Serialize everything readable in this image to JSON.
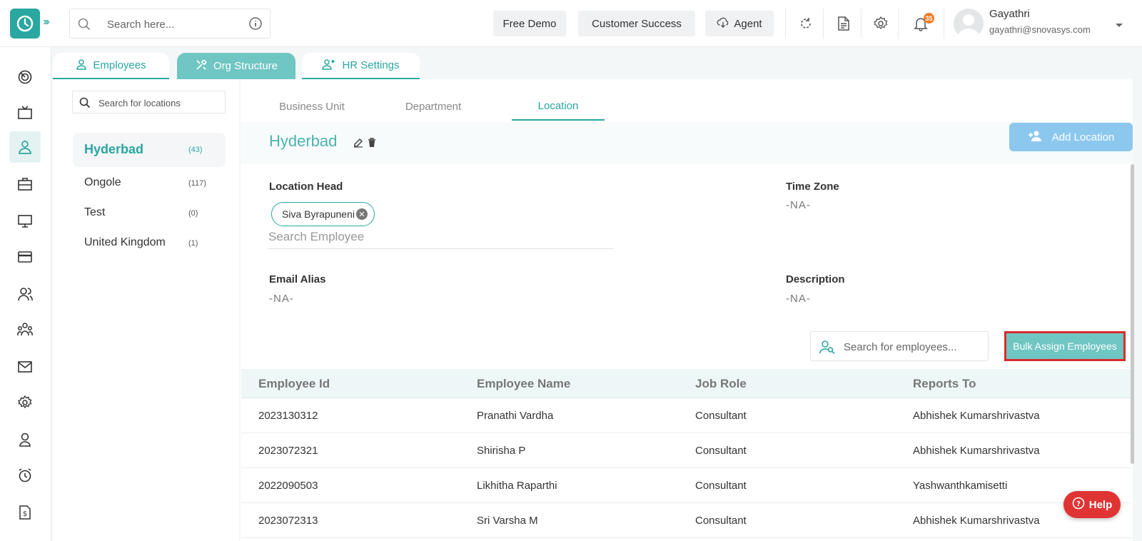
{
  "topbar": {
    "search_placeholder": "Search here...",
    "buttons": {
      "free_demo": "Free Demo",
      "customer_success": "Customer Success",
      "agent": "Agent"
    },
    "notification_count": "35",
    "user": {
      "name": "Gayathri",
      "email": "gayathri@snovasys.com"
    }
  },
  "tabs": [
    {
      "label": "Employees",
      "active": false
    },
    {
      "label": "Org Structure",
      "active": true
    },
    {
      "label": "HR Settings",
      "active": false
    }
  ],
  "locations": {
    "search_placeholder": "Search for locations",
    "items": [
      {
        "name": "Hyderbad",
        "count": "(43)",
        "active": true
      },
      {
        "name": "Ongole",
        "count": "(117)",
        "active": false
      },
      {
        "name": "Test",
        "count": "(0)",
        "active": false
      },
      {
        "name": "United Kingdom",
        "count": "(1)",
        "active": false
      }
    ]
  },
  "sub_tabs": [
    {
      "label": "Business Unit",
      "active": false
    },
    {
      "label": "Department",
      "active": false
    },
    {
      "label": "Location",
      "active": true
    }
  ],
  "detail": {
    "title": "Hyderbad",
    "add_location": "Add Location",
    "location_head_label": "Location Head",
    "location_head_chip": "Siva Byrapuneni",
    "search_employee_placeholder": "Search Employee",
    "time_zone_label": "Time Zone",
    "time_zone_value": "-NA-",
    "email_alias_label": "Email Alias",
    "email_alias_value": "-NA-",
    "description_label": "Description",
    "description_value": "-NA-",
    "search_employees_placeholder": "Search for employees...",
    "bulk_assign": "Bulk Assign Employees"
  },
  "table": {
    "headers": [
      "Employee Id",
      "Employee Name",
      "Job Role",
      "Reports To"
    ],
    "rows": [
      [
        "2023130312",
        "Pranathi Vardha",
        "Consultant",
        "Abhishek Kumarshrivastva"
      ],
      [
        "2023072321",
        "Shirisha P",
        "Consultant",
        "Abhishek Kumarshrivastva"
      ],
      [
        "2022090503",
        "Likhitha Raparthi",
        "Consultant",
        "Yashwanthkamisetti"
      ],
      [
        "2023072313",
        "Sri Varsha M",
        "Consultant",
        "Abhishek Kumarshrivastva"
      ]
    ]
  },
  "help_label": "Help",
  "colors": {
    "accent": "#2aa7a1",
    "tab_active": "#6fc6c3",
    "add_button": "#8cc8ee",
    "help": "#e03434",
    "highlight": "#d92b2b"
  }
}
